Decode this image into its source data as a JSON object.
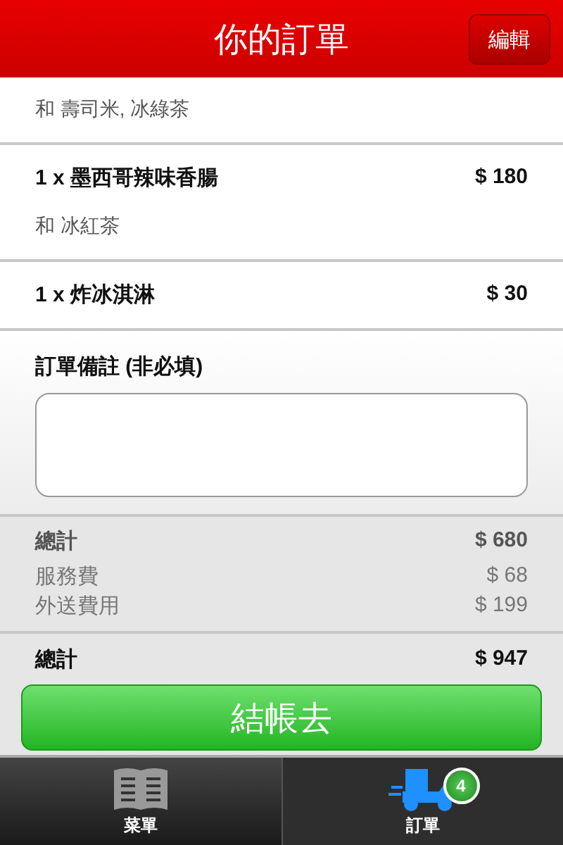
{
  "header": {
    "title": "你的訂單",
    "edit_button": "編輯"
  },
  "items": [
    {
      "note": "和 壽司米, 冰綠茶"
    },
    {
      "name": "1 x 墨西哥辣味香腸",
      "price": "$ 180",
      "note": "和 冰紅茶"
    },
    {
      "name": "1 x 炸冰淇淋",
      "price": "$ 30"
    }
  ],
  "remarks": {
    "label": "訂單備註 (非必填)"
  },
  "summary": [
    {
      "label": "總計",
      "value": "$ 680",
      "kind": "bold"
    },
    {
      "label": "服務費",
      "value": "$ 68",
      "kind": "fee"
    },
    {
      "label": "外送費用",
      "value": "$ 199",
      "kind": "fee"
    }
  ],
  "total": {
    "label": "總計",
    "value": "$ 947"
  },
  "checkout_button": "結帳去",
  "tabs": [
    {
      "label": "菜單",
      "kind": "menu",
      "selected": false
    },
    {
      "label": "訂單",
      "kind": "order",
      "selected": true,
      "badge": "4"
    }
  ]
}
